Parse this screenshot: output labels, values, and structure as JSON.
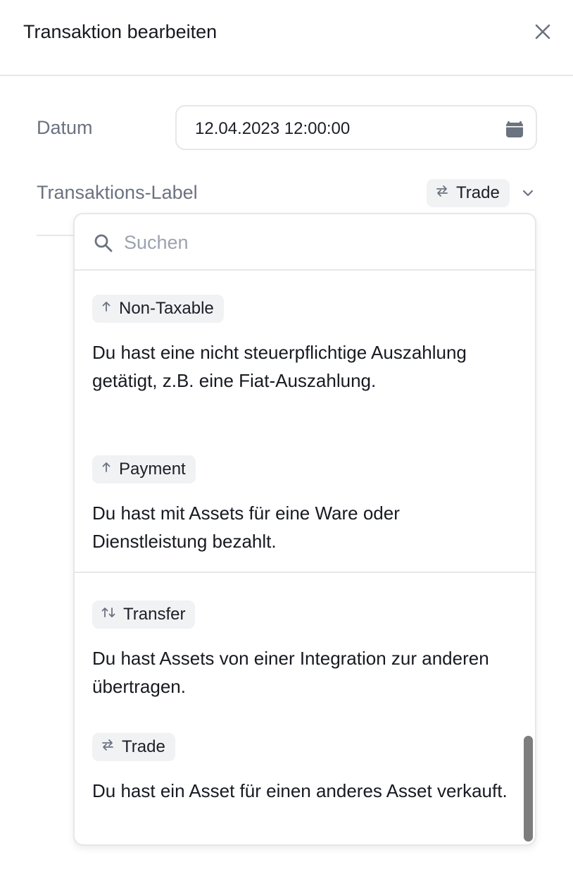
{
  "dialog": {
    "title": "Transaktion bearbeiten",
    "close_icon": "close-icon"
  },
  "form": {
    "date": {
      "label": "Datum",
      "value": "12.04.2023 12:00:00",
      "icon": "calendar-icon"
    },
    "transaction_label": {
      "label": "Transaktions-Label",
      "selected": "Trade",
      "selected_icon": "swap-arrows-icon",
      "chevron_icon": "chevron-down-icon"
    }
  },
  "dropdown": {
    "search": {
      "placeholder": "Suchen",
      "value": "",
      "icon": "search-icon"
    },
    "options": [
      {
        "label": "Non-Taxable",
        "icon": "arrow-up-icon",
        "description": "Du hast eine nicht steuerpflichtige Auszahlung getätigt, z.B. eine Fiat-Auszahlung."
      },
      {
        "label": "Payment",
        "icon": "arrow-up-icon",
        "description": "Du hast mit Assets für eine Ware oder Dienstleistung bezahlt."
      },
      {
        "label": "Transfer",
        "icon": "transfer-arrows-icon",
        "description": "Du hast Assets von einer Integration zur anderen übertragen."
      },
      {
        "label": "Trade",
        "icon": "swap-arrows-icon",
        "description": "Du hast ein Asset für einen anderes Asset verkauft."
      }
    ]
  },
  "colors": {
    "text": "#1b1f27",
    "muted": "#6b7280",
    "border": "#e5e7eb",
    "badge_bg": "#f1f2f4",
    "scrollbar": "#7d7d7d"
  }
}
